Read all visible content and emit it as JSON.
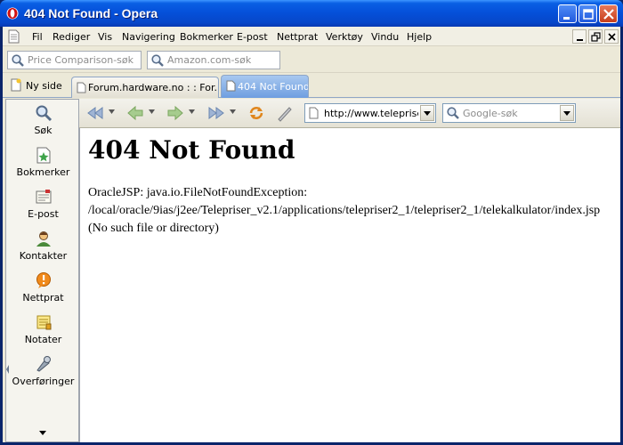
{
  "window": {
    "title": "404 Not Found - Opera"
  },
  "menubar": {
    "items": [
      "Fil",
      "Rediger",
      "Vis",
      "Navigering",
      "Bokmerker",
      "E-post",
      "Nettprat",
      "Verktøy",
      "Vindu",
      "Hjelp"
    ]
  },
  "searchbar": {
    "fields": [
      {
        "placeholder": "Price Comparison-søk",
        "icon": "search-icon"
      },
      {
        "placeholder": "Amazon.com-søk",
        "icon": "search-icon"
      }
    ]
  },
  "tabs": {
    "new_page_label": "Ny side",
    "items": [
      {
        "label": "Forum.hardware.no : : For...",
        "active": false
      },
      {
        "label": "404 Not Found",
        "active": true
      }
    ]
  },
  "panel": {
    "items": [
      {
        "label": "Søk",
        "icon": "search-icon"
      },
      {
        "label": "Bokmerker",
        "icon": "bookmark-icon"
      },
      {
        "label": "E-post",
        "icon": "mail-icon"
      },
      {
        "label": "Kontakter",
        "icon": "contacts-icon"
      },
      {
        "label": "Nettprat",
        "icon": "chat-icon"
      },
      {
        "label": "Notater",
        "icon": "notes-icon"
      },
      {
        "label": "Overføringer",
        "icon": "transfers-icon"
      }
    ]
  },
  "navbar": {
    "address": "http://www.telepriser",
    "search_placeholder": "Google-søk"
  },
  "page": {
    "heading": "404 Not Found",
    "message": "OracleJSP: java.io.FileNotFoundException: /local/oracle/9ias/j2ee/Telepriser_v2.1/applications/telepriser2_1/telepriser2_1/telekalkulator/index.jsp (No such file or directory)"
  },
  "colors": {
    "titlebar": "#0551da",
    "active_tab": "#6e9ee0",
    "chrome": "#ece9d8"
  }
}
